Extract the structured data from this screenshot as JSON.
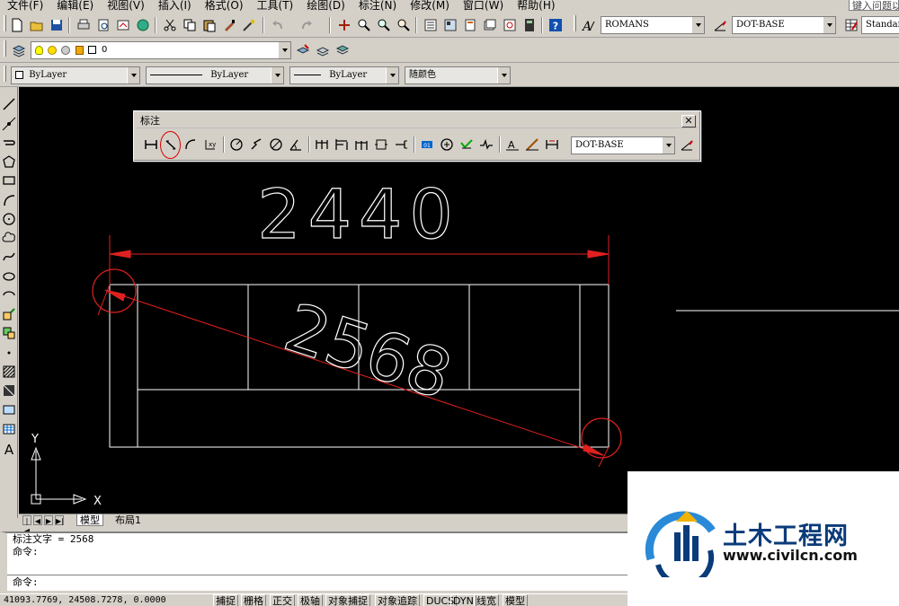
{
  "menu": {
    "items": [
      "文件(F)",
      "编辑(E)",
      "视图(V)",
      "插入(I)",
      "格式(O)",
      "工具(T)",
      "绘图(D)",
      "标注(N)",
      "修改(M)",
      "窗口(W)",
      "帮助(H)"
    ],
    "search_placeholder": "键入问题以"
  },
  "styles": {
    "text_style": "ROMANS",
    "dim_style": "DOT-BASE",
    "table_style": "Standard"
  },
  "layers": {
    "current_layer": "0"
  },
  "properties": {
    "color": "ByLayer",
    "linetype": "ByLayer",
    "lineweight": "ByLayer",
    "plotstyle": "随颜色"
  },
  "dim_toolbar": {
    "title": "标注",
    "close_label": "✕",
    "dim_style": "DOT-BASE"
  },
  "drawing": {
    "dim_horizontal": "2440",
    "dim_aligned": "2568",
    "ucs_x": "X",
    "ucs_y": "Y"
  },
  "tabs": {
    "model": "模型",
    "layout": "布局1"
  },
  "command": {
    "line1": "标注文字 = 2568",
    "line2": "命令:",
    "prompt": "命令:"
  },
  "status": {
    "coords": "41093.7769, 24508.7278, 0.0000",
    "buttons": [
      "捕捉",
      "栅格",
      "正交",
      "极轴",
      "对象捕捉",
      "对象追踪",
      "DUCS",
      "DYN",
      "线宽",
      "模型"
    ]
  },
  "watermark": {
    "brand": "土木工程网",
    "url": "www.civilcn.com"
  },
  "colors": {
    "canvas": "#000000",
    "dimension": "#e02020",
    "geometry": "#ffffff",
    "chrome": "#d4d0c8",
    "brand_blue": "#0a3b7a"
  }
}
